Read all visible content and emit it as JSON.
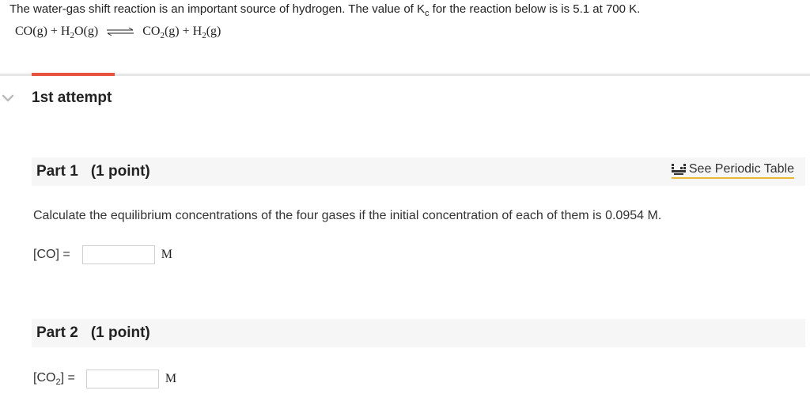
{
  "intro": {
    "text_before": "The water-gas shift reaction is an important source of hydrogen. The value of K",
    "kc_sub": "c",
    "text_after": " for the reaction below is is 5.1 at 700 K."
  },
  "equation": {
    "co": "CO",
    "phase_g": "(g)",
    "plus": " + ",
    "h": "H",
    "sub2": "2",
    "o": "O",
    "co2_co": "CO"
  },
  "attempt": {
    "label": "1st attempt"
  },
  "part1": {
    "title": "Part 1",
    "points": "(1 point)",
    "periodic_label": "See Periodic Table",
    "question": "Calculate the equilibrium concentrations of the four gases if the initial concentration of each of them is 0.0954 M.",
    "co_label": "[CO] =",
    "co_value": "",
    "unit": "M"
  },
  "part2": {
    "title": "Part 2",
    "points": "(1 point)",
    "co2_label_prefix": "[CO",
    "co2_label_sub": "2",
    "co2_label_suffix": "] =",
    "co2_value": "",
    "unit": "M"
  },
  "colors": {
    "accent": "#e8533f",
    "link_underline": "#e8b934",
    "part_bar": "#f6f6f6"
  }
}
